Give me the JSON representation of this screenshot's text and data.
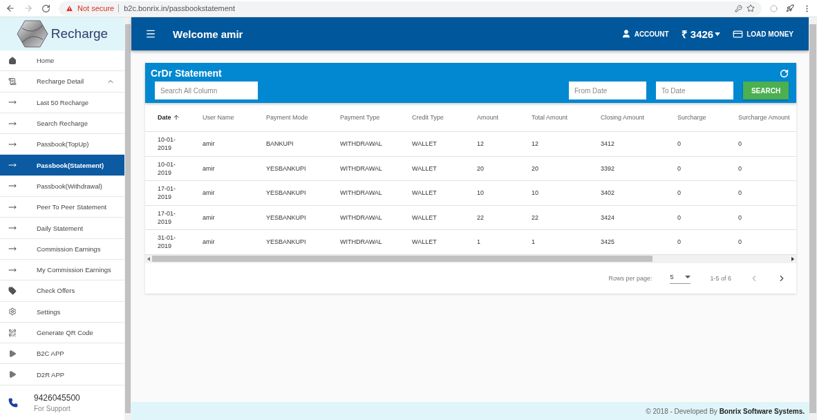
{
  "browser": {
    "security": "Not secure",
    "url": "b2c.bonrix.in/passbookstatement"
  },
  "sidebar": {
    "logo_text": "Recharge",
    "items": [
      {
        "label": "Home",
        "kind": "home",
        "selected": false
      },
      {
        "label": "Recharge Detail",
        "kind": "list",
        "selected": false,
        "expanded": true,
        "children": [
          {
            "label": "Last 50 Recharge",
            "kind": "arrow",
            "selected": false
          },
          {
            "label": "Search Recharge",
            "kind": "arrow",
            "selected": false
          },
          {
            "label": "Passbook(TopUp)",
            "kind": "arrow",
            "selected": false
          },
          {
            "label": "Passbook(Statement)",
            "kind": "arrow",
            "selected": true
          },
          {
            "label": "Passbook(Withdrawal)",
            "kind": "arrow",
            "selected": false
          },
          {
            "label": "Peer To Peer Statement",
            "kind": "arrow",
            "selected": false
          },
          {
            "label": "Daily Statement",
            "kind": "arrow",
            "selected": false
          },
          {
            "label": "Commission Earnings",
            "kind": "arrow",
            "selected": false
          },
          {
            "label": "My Commission Earnings",
            "kind": "arrow",
            "selected": false
          }
        ]
      },
      {
        "label": "Check Offers",
        "kind": "tag",
        "selected": false
      },
      {
        "label": "Settings",
        "kind": "gear",
        "selected": false
      },
      {
        "label": "Generate QR Code",
        "kind": "qr",
        "selected": false
      },
      {
        "label": "B2C APP",
        "kind": "play",
        "selected": false
      },
      {
        "label": "D2R APP",
        "kind": "play",
        "selected": false
      }
    ],
    "support": {
      "phone": "9426045500",
      "caption": "For Support"
    }
  },
  "header": {
    "title": "Welcome amir",
    "account": "ACCOUNT",
    "balance": "₹ 3426",
    "load_money": "LOAD MONEY"
  },
  "card": {
    "title": "CrDr Statement",
    "search_placeholder": "Search All Column",
    "from_placeholder": "From Date",
    "to_placeholder": "To Date",
    "search_button": "SEARCH"
  },
  "table": {
    "columns": [
      {
        "label": "Date",
        "sorted": true
      },
      {
        "label": "User Name",
        "sorted": false
      },
      {
        "label": "Payment Mode",
        "sorted": false
      },
      {
        "label": "Payment Type",
        "sorted": false
      },
      {
        "label": "Credit Type",
        "sorted": false
      },
      {
        "label": "Amount",
        "sorted": false
      },
      {
        "label": "Total Amount",
        "sorted": false
      },
      {
        "label": "Closing Amount",
        "sorted": false
      },
      {
        "label": "Surcharge",
        "sorted": false
      },
      {
        "label": "Surcharge Amount",
        "sorted": false
      }
    ],
    "rows": [
      [
        "10-01-2019",
        "amir",
        "BANKUPI",
        "WITHDRAWAL",
        "WALLET",
        "12",
        "12",
        "3412",
        "0",
        "0"
      ],
      [
        "10-01-2019",
        "amir",
        "YESBANKUPI",
        "WITHDRAWAL",
        "WALLET",
        "20",
        "20",
        "3392",
        "0",
        "0"
      ],
      [
        "17-01-2019",
        "amir",
        "YESBANKUPI",
        "WITHDRAWAL",
        "WALLET",
        "10",
        "10",
        "3402",
        "0",
        "0"
      ],
      [
        "17-01-2019",
        "amir",
        "YESBANKUPI",
        "WITHDRAWAL",
        "WALLET",
        "22",
        "22",
        "3424",
        "0",
        "0"
      ],
      [
        "31-01-2019",
        "amir",
        "YESBANKUPI",
        "WITHDRAWAL",
        "WALLET",
        "1",
        "1",
        "3425",
        "0",
        "0"
      ]
    ]
  },
  "pagination": {
    "rows_per_page_label": "Rows per page:",
    "rows_per_page": "5",
    "range": "1-5 of 6",
    "prev_disabled": true,
    "next_disabled": false
  },
  "footer": {
    "text": "© 2018 - Developed By **Bonrix Software Systems.**"
  }
}
